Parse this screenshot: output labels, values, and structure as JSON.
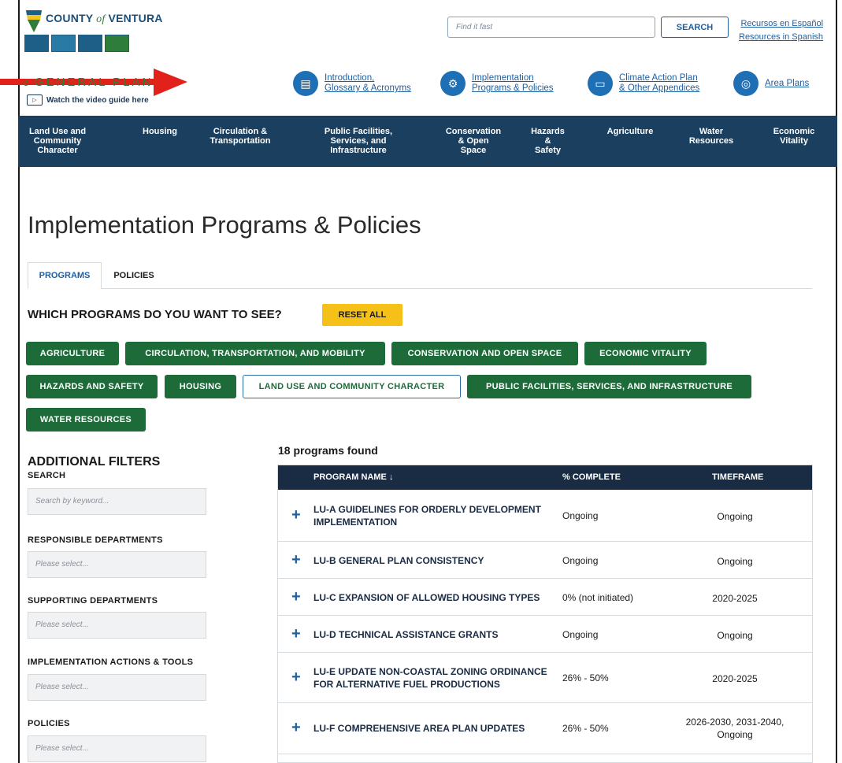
{
  "header": {
    "county_name_pre": "COUNTY",
    "county_name_of": "of",
    "county_name_post": "VENTURA",
    "egp_prefix": "e",
    "egp_text": "GENERAL PLAN",
    "video_label": "Watch the video guide here",
    "search_placeholder": "Find it fast",
    "search_button": "SEARCH",
    "lang_es": "Recursos en Español",
    "lang_en": "Resources in Spanish",
    "quick_links": [
      {
        "line1": "Introduction,",
        "line2": "Glossary & Acronyms",
        "icon": "book-icon"
      },
      {
        "line1": "Implementation",
        "line2": "Programs & Policies",
        "icon": "gears-icon"
      },
      {
        "line1": "Climate Action Plan",
        "line2": "& Other Appendices",
        "icon": "folder-icon"
      },
      {
        "line1": "Area Plans",
        "line2": "",
        "icon": "map-pin-icon"
      }
    ],
    "arrow_color": "#e0221b"
  },
  "nav": [
    {
      "l1": "Land Use and",
      "l2": "Community",
      "l3": "Character"
    },
    {
      "l1": "Housing",
      "l2": "",
      "l3": ""
    },
    {
      "l1": "Circulation &",
      "l2": "Transportation",
      "l3": ""
    },
    {
      "l1": "Public Facilities,",
      "l2": "Services, and",
      "l3": "Infrastructure"
    },
    {
      "l1": "Conservation",
      "l2": "& Open",
      "l3": "Space"
    },
    {
      "l1": "Hazards",
      "l2": "&",
      "l3": "Safety"
    },
    {
      "l1": "Agriculture",
      "l2": "",
      "l3": ""
    },
    {
      "l1": "Water",
      "l2": "Resources",
      "l3": ""
    },
    {
      "l1": "Economic",
      "l2": "Vitality",
      "l3": ""
    }
  ],
  "main": {
    "title": "Implementation Programs & Policies",
    "tabs": [
      "PROGRAMS",
      "POLICIES"
    ],
    "which_heading": "WHICH PROGRAMS DO YOU WANT TO SEE?",
    "reset_label": "RESET ALL",
    "chips": [
      "AGRICULTURE",
      "CIRCULATION, TRANSPORTATION, AND MOBILITY",
      "CONSERVATION AND OPEN SPACE",
      "ECONOMIC VITALITY",
      "HAZARDS AND SAFETY",
      "HOUSING",
      "LAND USE AND COMMUNITY CHARACTER",
      "PUBLIC FACILITIES, SERVICES, AND INFRASTRUCTURE",
      "WATER RESOURCES"
    ],
    "selected_chip": "LAND USE AND COMMUNITY CHARACTER"
  },
  "filters": {
    "title": "ADDITIONAL FILTERS",
    "search_label": "SEARCH",
    "search_placeholder": "Search by keyword...",
    "responsible_label": "RESPONSIBLE DEPARTMENTS",
    "supporting_label": "SUPPORTING DEPARTMENTS",
    "actions_label": "IMPLEMENTATION ACTIONS & TOOLS",
    "policies_label": "POLICIES",
    "select_placeholder": "Please select..."
  },
  "results": {
    "found": "18 programs found",
    "columns": [
      "PROGRAM NAME ↓",
      "% COMPLETE",
      "TIMEFRAME"
    ],
    "rows": [
      {
        "name_l1": "LU-A GUIDELINES FOR ORDERLY DEVELOPMENT",
        "name_l2": "IMPLEMENTATION",
        "pct": "Ongoing",
        "tf_l1": "Ongoing",
        "tf_l2": ""
      },
      {
        "name_l1": "LU-B GENERAL PLAN CONSISTENCY",
        "name_l2": "",
        "pct": "Ongoing",
        "tf_l1": "Ongoing",
        "tf_l2": ""
      },
      {
        "name_l1": "LU-C EXPANSION OF ALLOWED HOUSING TYPES",
        "name_l2": "",
        "pct": "0% (not initiated)",
        "tf_l1": "2020-2025",
        "tf_l2": ""
      },
      {
        "name_l1": "LU-D TECHNICAL ASSISTANCE GRANTS",
        "name_l2": "",
        "pct": "Ongoing",
        "tf_l1": "Ongoing",
        "tf_l2": ""
      },
      {
        "name_l1": "LU-E UPDATE NON-COASTAL ZONING ORDINANCE",
        "name_l2": "FOR ALTERNATIVE FUEL PRODUCTIONS",
        "pct": "26% - 50%",
        "tf_l1": "2020-2025",
        "tf_l2": ""
      },
      {
        "name_l1": "LU-F COMPREHENSIVE AREA PLAN UPDATES",
        "name_l2": "",
        "pct": "26% - 50%",
        "tf_l1": "2026-2030, 2031-2040,",
        "tf_l2": "Ongoing"
      }
    ]
  }
}
